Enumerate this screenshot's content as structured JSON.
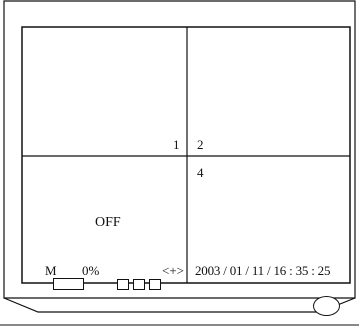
{
  "screen": {
    "channel_1_label": "1",
    "channel_2_label": "2",
    "channel_4_label": "4",
    "status_text": "OFF",
    "mode_label": "M",
    "percent_label": "0%",
    "arrow_indicator": "<+>",
    "datetime": "2003 / 01 / 11 / 16 : 35 : 25"
  },
  "controls": {
    "buttons": [
      "wide-button",
      "square-button",
      "square-button",
      "square-button"
    ],
    "knob": "power-knob"
  }
}
